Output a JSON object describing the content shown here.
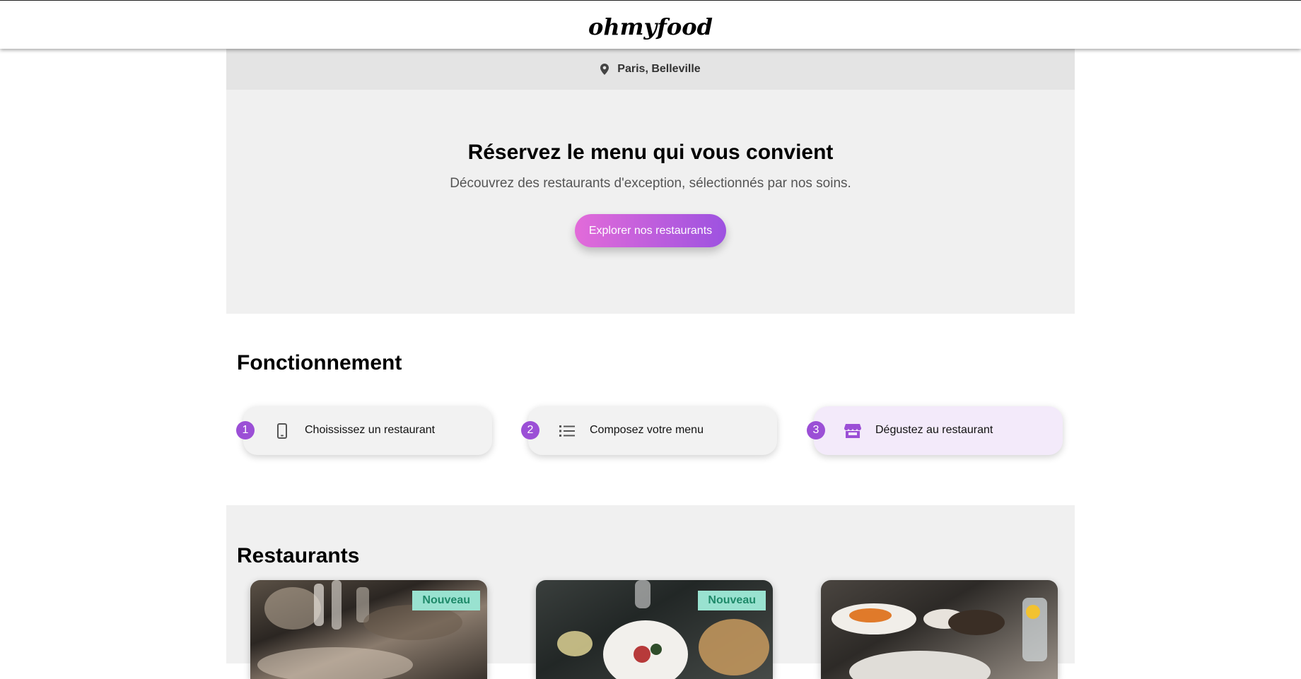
{
  "header": {
    "logo": "ohmyfood"
  },
  "location": {
    "text": "Paris, Belleville",
    "icon": "map-pin-icon"
  },
  "hero": {
    "title": "Réservez le menu qui vous convient",
    "subtitle": "Découvrez des restaurants d'exception, sélectionnés par nos soins.",
    "cta_label": "Explorer nos restaurants"
  },
  "how": {
    "title": "Fonctionnement",
    "steps": [
      {
        "num": "1",
        "label": "Choississez un restaurant",
        "icon": "phone-icon"
      },
      {
        "num": "2",
        "label": "Composez votre menu",
        "icon": "list-icon"
      },
      {
        "num": "3",
        "label": "Dégustez au restaurant",
        "icon": "store-icon"
      }
    ]
  },
  "restaurants": {
    "title": "Restaurants",
    "cards": [
      {
        "badge": "Nouveau"
      },
      {
        "badge": "Nouveau"
      },
      {
        "badge": ""
      }
    ]
  },
  "colors": {
    "accent": "#9b4fd6",
    "gradient_start": "#e26bd9",
    "gradient_end": "#9d52e0",
    "badge_bg": "#99e2d0",
    "badge_text": "#1f8a6a"
  }
}
